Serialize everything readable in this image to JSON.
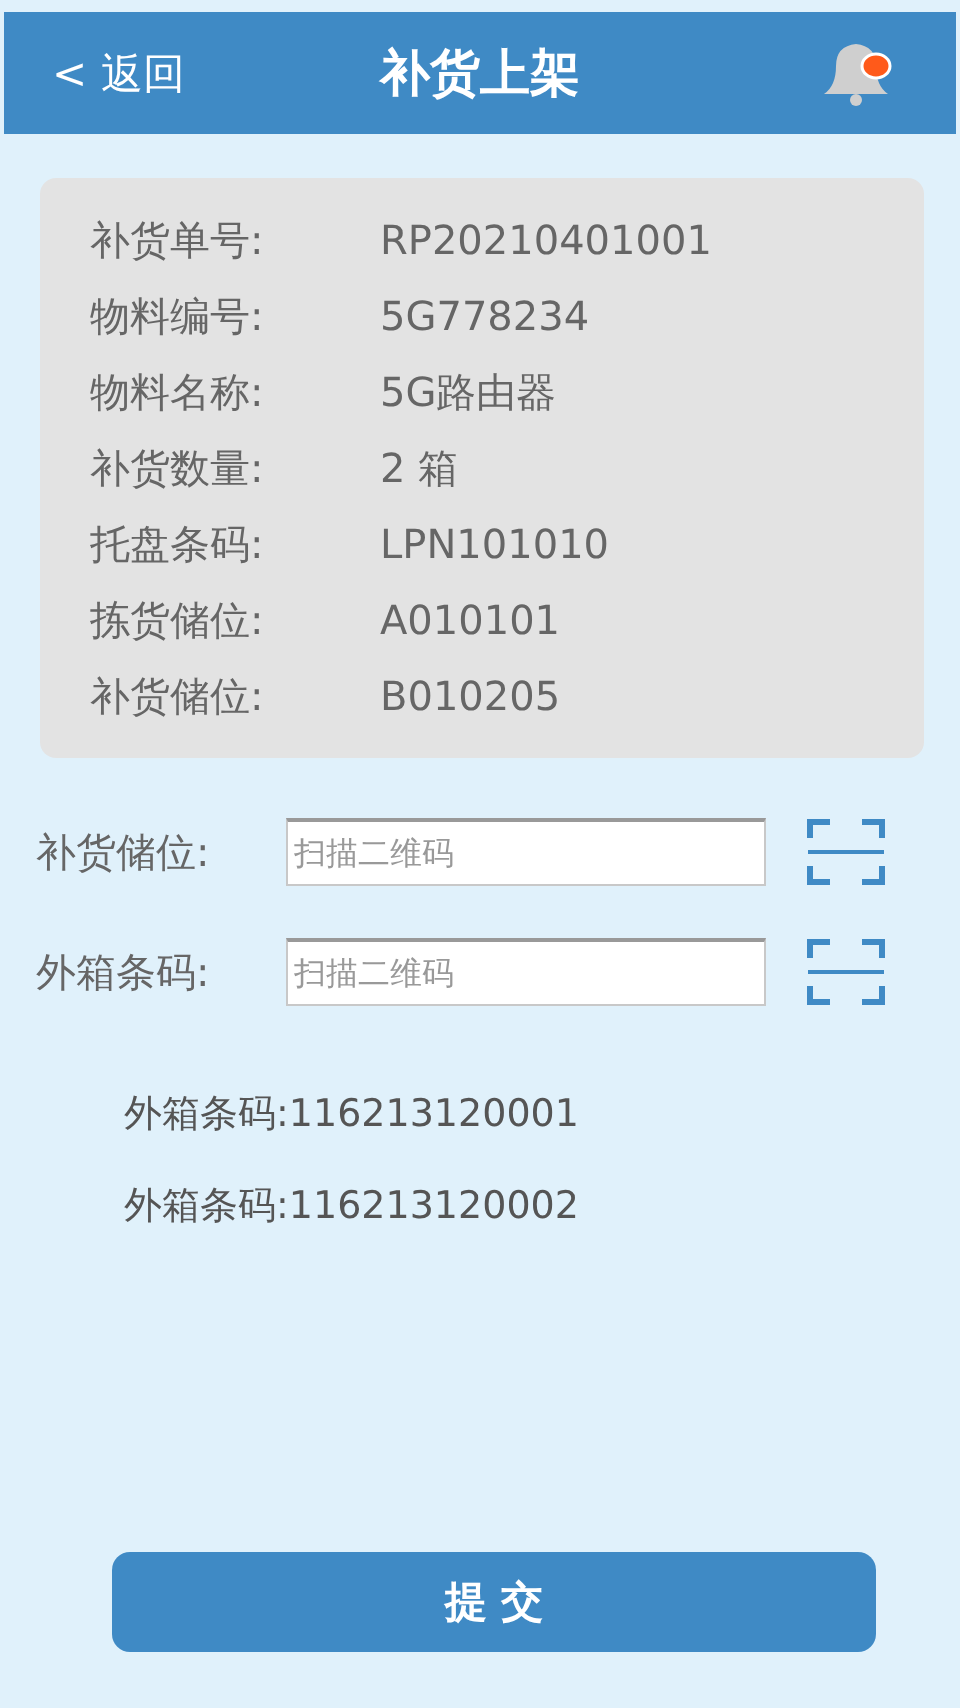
{
  "header": {
    "back": "< 返回",
    "title": "补货上架",
    "notification": true
  },
  "details": [
    {
      "label": "补货单号:",
      "value": "RP20210401001"
    },
    {
      "label": "物料编号:",
      "value": "5G778234"
    },
    {
      "label": "物料名称:",
      "value": "5G路由器"
    },
    {
      "label": "补货数量:",
      "value": "2 箱"
    },
    {
      "label": "托盘条码:",
      "value": "LPN101010"
    },
    {
      "label": "拣货储位:",
      "value": "A010101"
    },
    {
      "label": "补货储位:",
      "value": "B010205"
    }
  ],
  "scan_fields": [
    {
      "label": "补货储位:",
      "placeholder": "扫描二维码"
    },
    {
      "label": "外箱条码:",
      "placeholder": "扫描二维码"
    }
  ],
  "scanned": [
    {
      "label": "外箱条码:",
      "value": "116213120001"
    },
    {
      "label": "外箱条码:",
      "value": "116213120002"
    }
  ],
  "submit": "提 交"
}
